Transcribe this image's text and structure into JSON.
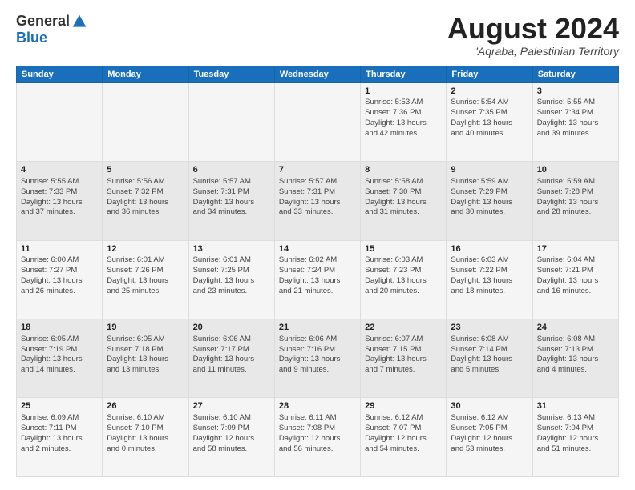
{
  "logo": {
    "general": "General",
    "blue": "Blue"
  },
  "header": {
    "month_year": "August 2024",
    "location": "'Aqraba, Palestinian Territory"
  },
  "days_of_week": [
    "Sunday",
    "Monday",
    "Tuesday",
    "Wednesday",
    "Thursday",
    "Friday",
    "Saturday"
  ],
  "weeks": [
    [
      {
        "day": "",
        "info": ""
      },
      {
        "day": "",
        "info": ""
      },
      {
        "day": "",
        "info": ""
      },
      {
        "day": "",
        "info": ""
      },
      {
        "day": "1",
        "info": "Sunrise: 5:53 AM\nSunset: 7:36 PM\nDaylight: 13 hours\nand 42 minutes."
      },
      {
        "day": "2",
        "info": "Sunrise: 5:54 AM\nSunset: 7:35 PM\nDaylight: 13 hours\nand 40 minutes."
      },
      {
        "day": "3",
        "info": "Sunrise: 5:55 AM\nSunset: 7:34 PM\nDaylight: 13 hours\nand 39 minutes."
      }
    ],
    [
      {
        "day": "4",
        "info": "Sunrise: 5:55 AM\nSunset: 7:33 PM\nDaylight: 13 hours\nand 37 minutes."
      },
      {
        "day": "5",
        "info": "Sunrise: 5:56 AM\nSunset: 7:32 PM\nDaylight: 13 hours\nand 36 minutes."
      },
      {
        "day": "6",
        "info": "Sunrise: 5:57 AM\nSunset: 7:31 PM\nDaylight: 13 hours\nand 34 minutes."
      },
      {
        "day": "7",
        "info": "Sunrise: 5:57 AM\nSunset: 7:31 PM\nDaylight: 13 hours\nand 33 minutes."
      },
      {
        "day": "8",
        "info": "Sunrise: 5:58 AM\nSunset: 7:30 PM\nDaylight: 13 hours\nand 31 minutes."
      },
      {
        "day": "9",
        "info": "Sunrise: 5:59 AM\nSunset: 7:29 PM\nDaylight: 13 hours\nand 30 minutes."
      },
      {
        "day": "10",
        "info": "Sunrise: 5:59 AM\nSunset: 7:28 PM\nDaylight: 13 hours\nand 28 minutes."
      }
    ],
    [
      {
        "day": "11",
        "info": "Sunrise: 6:00 AM\nSunset: 7:27 PM\nDaylight: 13 hours\nand 26 minutes."
      },
      {
        "day": "12",
        "info": "Sunrise: 6:01 AM\nSunset: 7:26 PM\nDaylight: 13 hours\nand 25 minutes."
      },
      {
        "day": "13",
        "info": "Sunrise: 6:01 AM\nSunset: 7:25 PM\nDaylight: 13 hours\nand 23 minutes."
      },
      {
        "day": "14",
        "info": "Sunrise: 6:02 AM\nSunset: 7:24 PM\nDaylight: 13 hours\nand 21 minutes."
      },
      {
        "day": "15",
        "info": "Sunrise: 6:03 AM\nSunset: 7:23 PM\nDaylight: 13 hours\nand 20 minutes."
      },
      {
        "day": "16",
        "info": "Sunrise: 6:03 AM\nSunset: 7:22 PM\nDaylight: 13 hours\nand 18 minutes."
      },
      {
        "day": "17",
        "info": "Sunrise: 6:04 AM\nSunset: 7:21 PM\nDaylight: 13 hours\nand 16 minutes."
      }
    ],
    [
      {
        "day": "18",
        "info": "Sunrise: 6:05 AM\nSunset: 7:19 PM\nDaylight: 13 hours\nand 14 minutes."
      },
      {
        "day": "19",
        "info": "Sunrise: 6:05 AM\nSunset: 7:18 PM\nDaylight: 13 hours\nand 13 minutes."
      },
      {
        "day": "20",
        "info": "Sunrise: 6:06 AM\nSunset: 7:17 PM\nDaylight: 13 hours\nand 11 minutes."
      },
      {
        "day": "21",
        "info": "Sunrise: 6:06 AM\nSunset: 7:16 PM\nDaylight: 13 hours\nand 9 minutes."
      },
      {
        "day": "22",
        "info": "Sunrise: 6:07 AM\nSunset: 7:15 PM\nDaylight: 13 hours\nand 7 minutes."
      },
      {
        "day": "23",
        "info": "Sunrise: 6:08 AM\nSunset: 7:14 PM\nDaylight: 13 hours\nand 5 minutes."
      },
      {
        "day": "24",
        "info": "Sunrise: 6:08 AM\nSunset: 7:13 PM\nDaylight: 13 hours\nand 4 minutes."
      }
    ],
    [
      {
        "day": "25",
        "info": "Sunrise: 6:09 AM\nSunset: 7:11 PM\nDaylight: 13 hours\nand 2 minutes."
      },
      {
        "day": "26",
        "info": "Sunrise: 6:10 AM\nSunset: 7:10 PM\nDaylight: 13 hours\nand 0 minutes."
      },
      {
        "day": "27",
        "info": "Sunrise: 6:10 AM\nSunset: 7:09 PM\nDaylight: 12 hours\nand 58 minutes."
      },
      {
        "day": "28",
        "info": "Sunrise: 6:11 AM\nSunset: 7:08 PM\nDaylight: 12 hours\nand 56 minutes."
      },
      {
        "day": "29",
        "info": "Sunrise: 6:12 AM\nSunset: 7:07 PM\nDaylight: 12 hours\nand 54 minutes."
      },
      {
        "day": "30",
        "info": "Sunrise: 6:12 AM\nSunset: 7:05 PM\nDaylight: 12 hours\nand 53 minutes."
      },
      {
        "day": "31",
        "info": "Sunrise: 6:13 AM\nSunset: 7:04 PM\nDaylight: 12 hours\nand 51 minutes."
      }
    ]
  ]
}
